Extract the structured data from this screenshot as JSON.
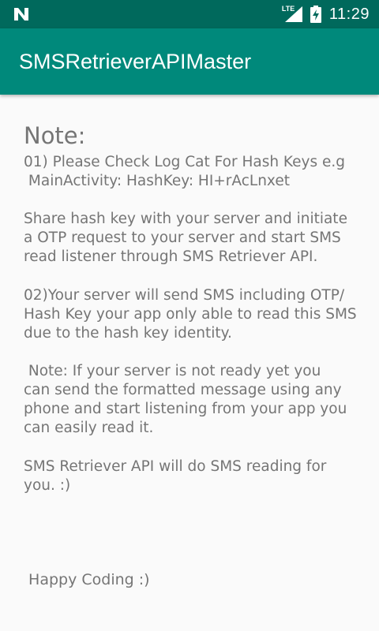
{
  "status_bar": {
    "time": "11:29",
    "network_label": "LTE",
    "icons": [
      "notification-n-icon",
      "lte-signal-icon",
      "battery-charging-icon"
    ]
  },
  "app_bar": {
    "title": "SMSRetrieverAPIMaster",
    "color": "#00897b",
    "status_color": "#00695c"
  },
  "content": {
    "heading": "Note:",
    "body": "01) Please Check Log Cat For Hash Keys e.g\n MainActivity: HashKey: HI+rAcLnxet\n\nShare hash key with your server and initiate\na OTP request to your server and start SMS\nread listener through SMS Retriever API.\n\n02)Your server will send SMS including OTP/\nHash Key your app only able to read this SMS\ndue to the hash key identity.\n\n Note: If your server is not ready yet you\ncan send the formatted message using any\nphone and start listening from your app you\ncan easily read it.\n\nSMS Retriever API will do SMS reading for\nyou. :)",
    "footer": " Happy Coding :)",
    "text_color": "#757575"
  }
}
